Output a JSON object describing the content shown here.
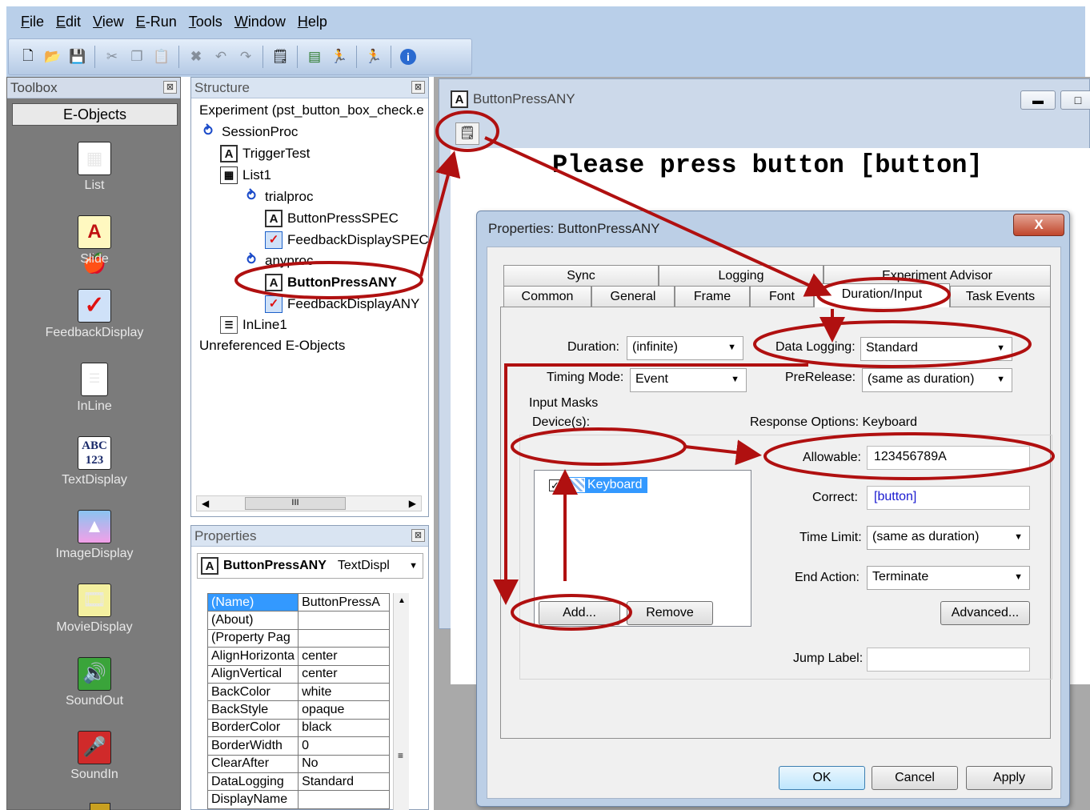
{
  "menu": [
    "File",
    "Edit",
    "View",
    "E-Run",
    "Tools",
    "Window",
    "Help"
  ],
  "toolbar_icons": [
    "new-icon",
    "open-icon",
    "save-icon",
    "cut-icon",
    "copy-icon",
    "paste-icon",
    "delete-icon",
    "undo-icon",
    "redo-icon",
    "properties-icon",
    "generate-icon",
    "run-icon",
    "run-test-icon",
    "about-icon"
  ],
  "toolbox": {
    "title": "Toolbox",
    "category": "E-Objects",
    "items": [
      {
        "label": "List",
        "icon": "list-icon"
      },
      {
        "label": "Slide",
        "icon": "slide-icon"
      },
      {
        "label": "FeedbackDisplay",
        "icon": "feedback-display-icon"
      },
      {
        "label": "InLine",
        "icon": "inline-icon"
      },
      {
        "label": "TextDisplay",
        "icon": "text-display-icon"
      },
      {
        "label": "ImageDisplay",
        "icon": "image-display-icon"
      },
      {
        "label": "MovieDisplay",
        "icon": "movie-display-icon"
      },
      {
        "label": "SoundOut",
        "icon": "sound-out-icon"
      },
      {
        "label": "SoundIn",
        "icon": "sound-in-icon"
      }
    ]
  },
  "structure": {
    "title": "Structure",
    "nodes": [
      {
        "label": "Experiment (pst_button_box_check.e",
        "depth": 0
      },
      {
        "label": "SessionProc",
        "depth": 0
      },
      {
        "label": "TriggerTest",
        "depth": 1
      },
      {
        "label": "List1",
        "depth": 1
      },
      {
        "label": "trialproc",
        "depth": 2
      },
      {
        "label": "ButtonPressSPEC",
        "depth": 3
      },
      {
        "label": "FeedbackDisplaySPEC",
        "depth": 3
      },
      {
        "label": "anyproc",
        "depth": 2
      },
      {
        "label": "ButtonPressANY",
        "depth": 3
      },
      {
        "label": "FeedbackDisplayANY",
        "depth": 3
      },
      {
        "label": "InLine1",
        "depth": 1
      },
      {
        "label": "Unreferenced E-Objects",
        "depth": 0
      }
    ],
    "scroll_glyph": "III"
  },
  "properties_panel": {
    "title": "Properties",
    "object_name": "ButtonPressANY",
    "object_type": "TextDispl",
    "rows": [
      [
        "(Name)",
        "ButtonPressA"
      ],
      [
        "(About)",
        ""
      ],
      [
        "(Property Pag",
        ""
      ],
      [
        "AlignHorizonta",
        "center"
      ],
      [
        "AlignVertical",
        "center"
      ],
      [
        "BackColor",
        "white"
      ],
      [
        "BackStyle",
        "opaque"
      ],
      [
        "BorderColor",
        "black"
      ],
      [
        "BorderWidth",
        "0"
      ],
      [
        "ClearAfter",
        "No"
      ],
      [
        "DataLogging",
        "Standard"
      ],
      [
        "DisplayName",
        ""
      ]
    ]
  },
  "document": {
    "title": "ButtonPressANY",
    "display_text": "Please press button [button]"
  },
  "dialog": {
    "title": "Properties: ButtonPressANY",
    "close_label": "X",
    "tabs_row1": [
      "Sync",
      "Logging",
      "Experiment Advisor"
    ],
    "tabs_row2": [
      "Common",
      "General",
      "Frame",
      "Font",
      "Duration/Input",
      "Task Events"
    ],
    "active_tab": "Duration/Input",
    "duration_label": "Duration:",
    "duration_value": "(infinite)",
    "data_logging_label": "Data Logging:",
    "data_logging_value": "Standard",
    "timing_mode_label": "Timing Mode:",
    "timing_mode_value": "Event",
    "prerelease_label": "PreRelease:",
    "prerelease_value": "(same as duration)",
    "input_masks_label": "Input Masks",
    "devices_label": "Device(s):",
    "device": "Keyboard",
    "response_options_label": "Response Options:",
    "response_options_device": "Keyboard",
    "allowable_label": "Allowable:",
    "allowable_value": "123456789A",
    "correct_label": "Correct:",
    "correct_value": "[button]",
    "time_limit_label": "Time Limit:",
    "time_limit_value": "(same as duration)",
    "end_action_label": "End Action:",
    "end_action_value": "Terminate",
    "add_label": "Add...",
    "remove_label": "Remove",
    "advanced_label": "Advanced...",
    "jump_label_label": "Jump Label:",
    "jump_label_value": "",
    "ok_label": "OK",
    "cancel_label": "Cancel",
    "apply_label": "Apply"
  },
  "colors": {
    "annotation": "#b01010",
    "selection": "#3399ff",
    "correct_value_text": "#1a1ad0"
  }
}
